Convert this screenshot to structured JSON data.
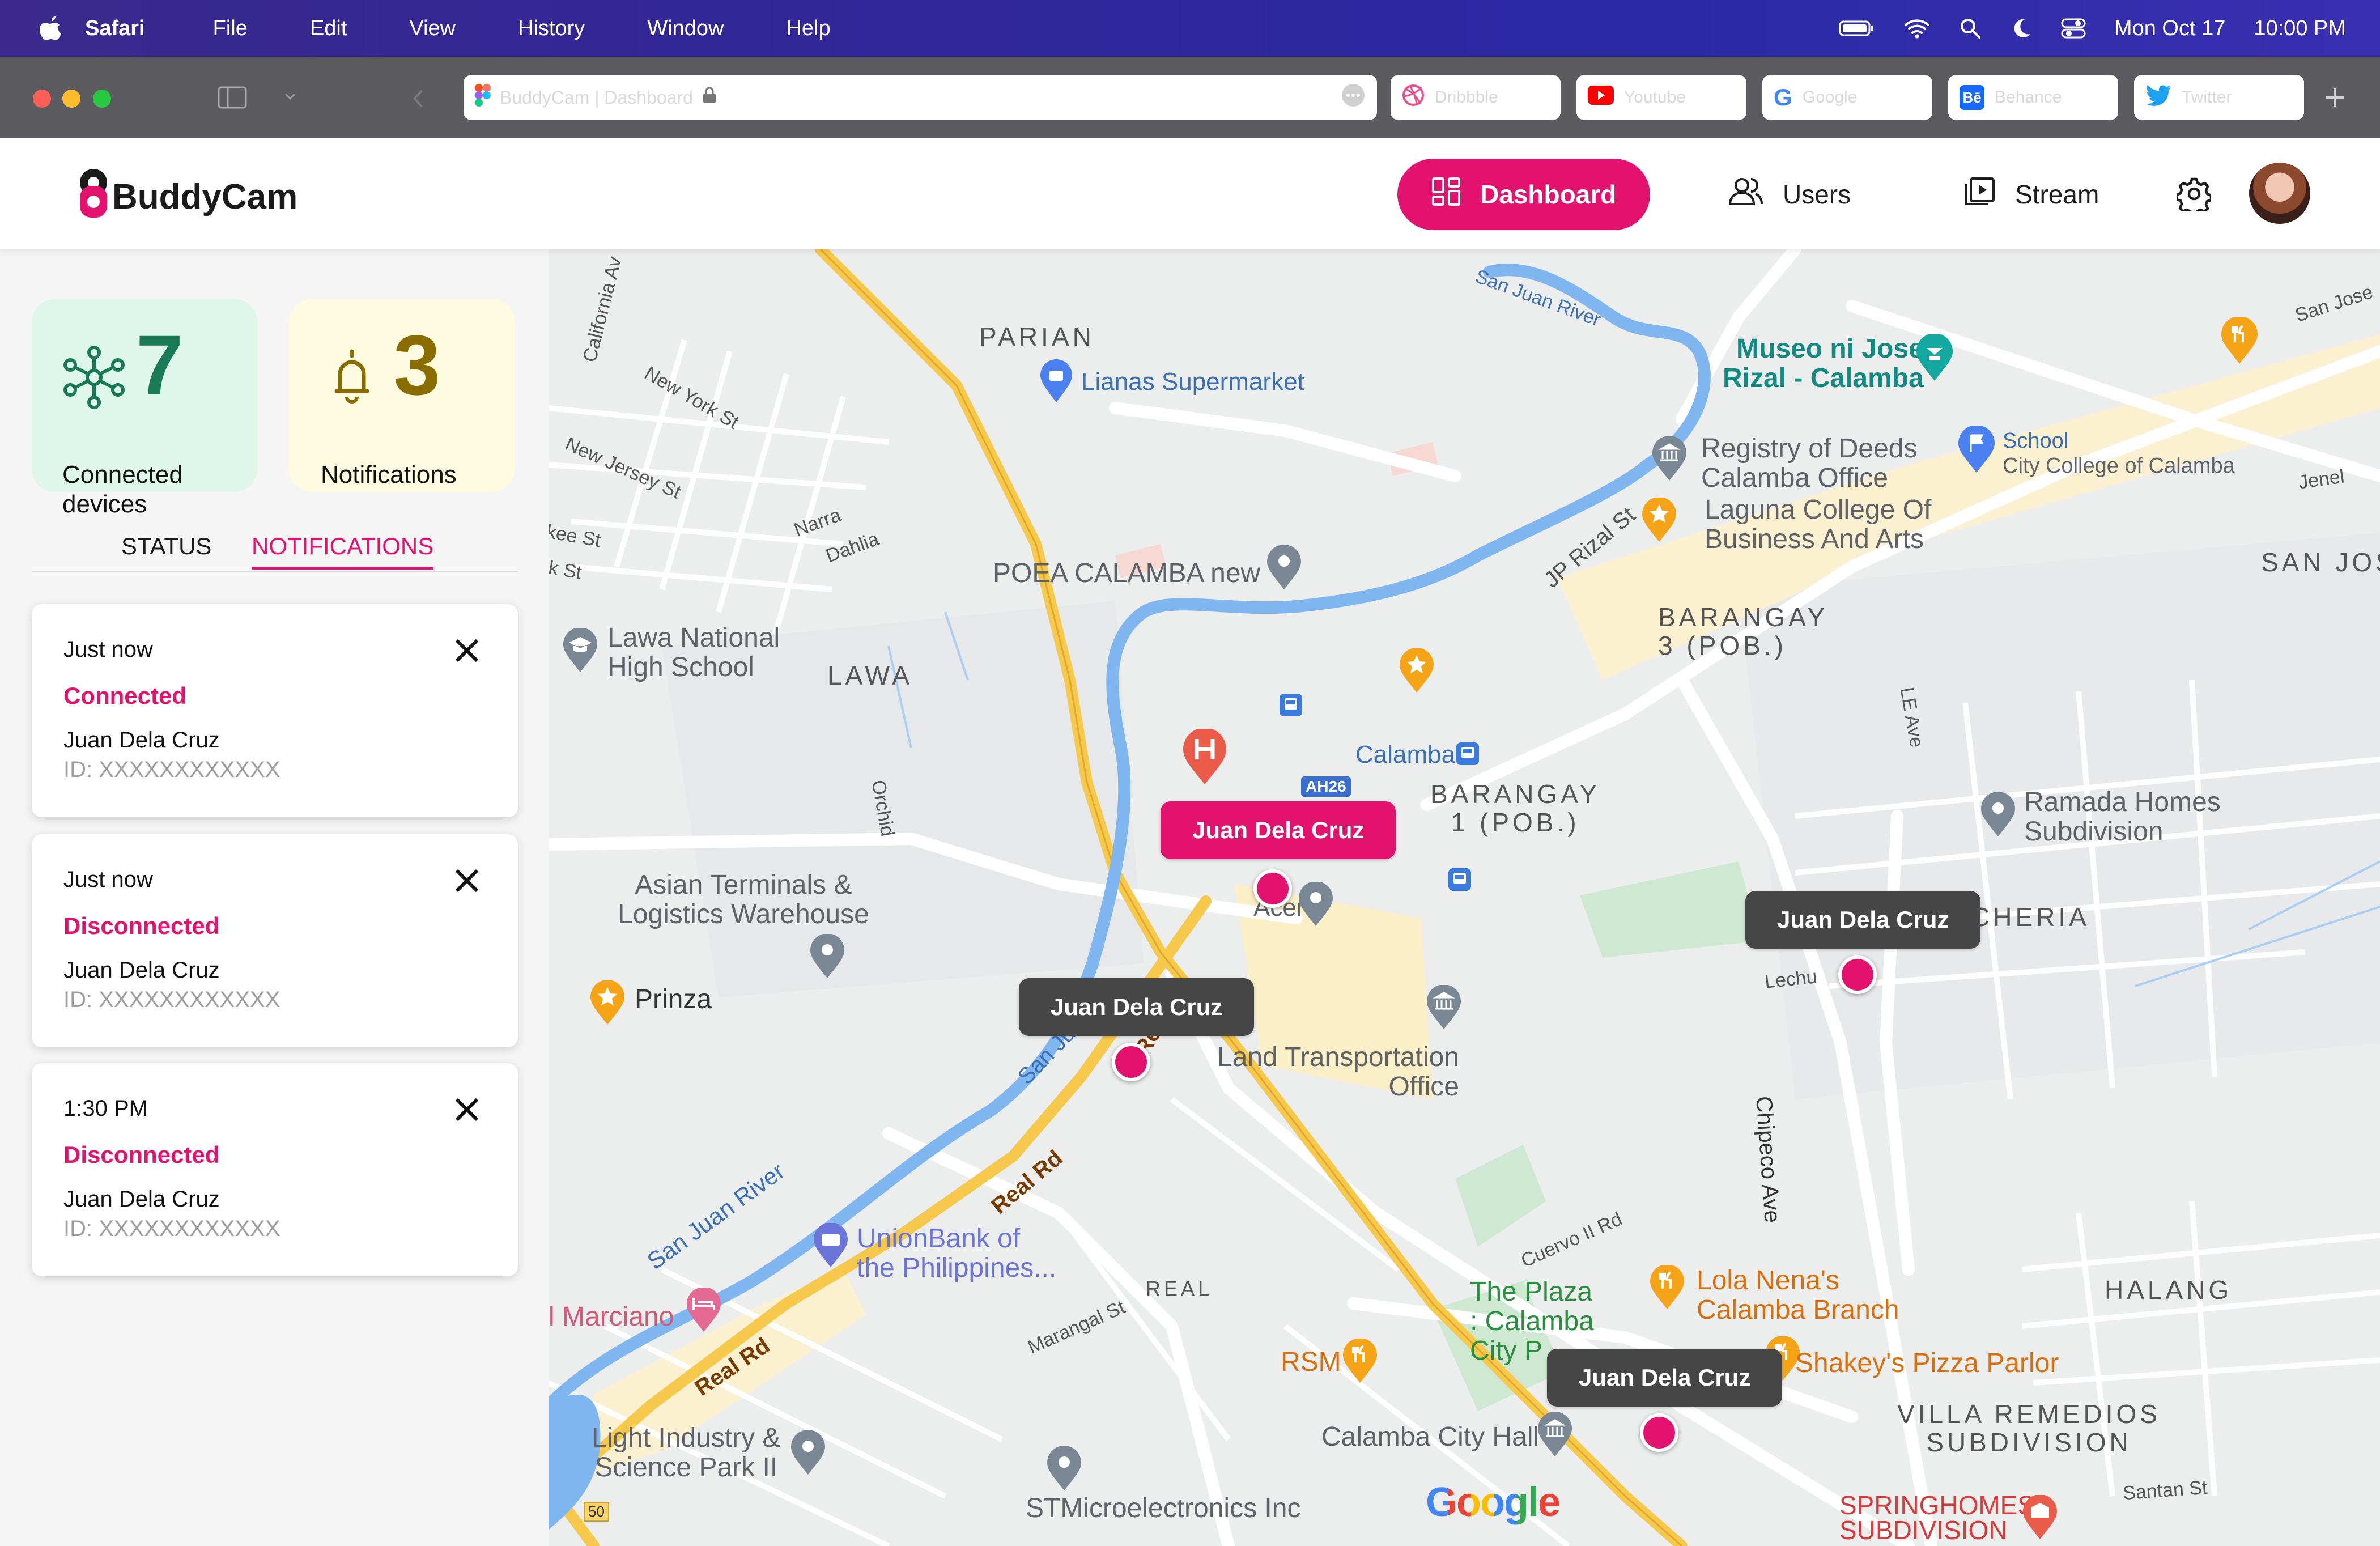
{
  "menubar": {
    "app": "Safari",
    "items": [
      "File",
      "Edit",
      "View",
      "History",
      "Window",
      "Help"
    ],
    "date": "Mon Oct 17",
    "time": "10:00 PM"
  },
  "browser": {
    "url_text": "BuddyCam | Dashboard",
    "tabs": [
      "Dribbble",
      "Youtube",
      "Google",
      "Behance",
      "Twitter"
    ]
  },
  "header": {
    "brand": "BuddyCam",
    "nav": {
      "dashboard": "Dashboard",
      "users": "Users",
      "stream": "Stream"
    }
  },
  "stats": {
    "connected": {
      "value": "7",
      "label": "Connected devices"
    },
    "notifications": {
      "value": "3",
      "label": "Notifications"
    }
  },
  "tabs": {
    "status": "STATUS",
    "notifications": "NOTIFICATIONS",
    "active": "notifications"
  },
  "notifications": [
    {
      "time": "Just now",
      "status": "Connected",
      "name": "Juan Dela Cruz",
      "id": "ID: XXXXXXXXXXXX"
    },
    {
      "time": "Just now",
      "status": "Disconnected",
      "name": "Juan Dela Cruz",
      "id": "ID: XXXXXXXXXXXX"
    },
    {
      "time": "1:30 PM",
      "status": "Disconnected",
      "name": "Juan Dela Cruz",
      "id": "ID: XXXXXXXXXXXX"
    }
  ],
  "map": {
    "markers": [
      {
        "label": "Juan Dela Cruz",
        "highlight": true
      },
      {
        "label": "Juan Dela Cruz",
        "highlight": false
      },
      {
        "label": "Juan Dela Cruz",
        "highlight": false
      },
      {
        "label": "Juan Dela Cruz",
        "highlight": false
      }
    ],
    "labels": {
      "parian": "PARIAN",
      "lianas": "Lianas Supermarket",
      "museo": "Museo ni Jose\nRizal - Calamba",
      "registry": "Registry of Deeds\nCalamba Office",
      "school": "School",
      "city_college": "City College of Calamba",
      "laguna_college": "Laguna College Of\nBusiness And Arts",
      "poea": "POEA CALAMBA new",
      "lawa_nhs": "Lawa National\nHigh School",
      "lawa": "LAWA",
      "barangay3": "BARANGAY\n3 (POB.)",
      "san_jos": "SAN JOS",
      "calamba": "Calamba",
      "barangay1": "BARANGAY\n1 (POB.)",
      "ramada": "Ramada Homes\nSubdivision",
      "asian_terminals": "Asian Terminals &\nLogistics Warehouse",
      "cheria": "CHERIA",
      "prinza": "Prinza",
      "acer": "Acer",
      "lto": "Land Transportation\nOffice",
      "unionbank": "UnionBank of\nthe Philippines...",
      "marciano": "l Marciano",
      "plaza": "The Plaza\n: Calamba\nCity P",
      "lola_nena": "Lola Nena's\nCalamba Branch",
      "halang": "HALANG",
      "rsm": "RSM",
      "shakeys": "Shakey's Pizza Parlor",
      "villa": "VILLA REMEDIOS\nSUBDIVISION",
      "light_industry": "Light Industry &\nScience Park II",
      "city_hall": "Calamba City Hall",
      "stmicro": "STMicroelectronics Inc",
      "springhomes": "SPRINGHOMES\nSUBDIVISION",
      "real": "REAL",
      "ah26": "AH26",
      "google": "Google"
    },
    "streets": {
      "san_juan_river_top": "San Juan River",
      "san_juan_river_bottom": "San Juan River",
      "san_juan_mid": "San Juan",
      "real_rd_1": "Real Rd",
      "real_rd_2": "Real Rd",
      "jp_rizal": "JP Rizal St",
      "california": "California Av",
      "new_york": "New York St",
      "new_jersey": "New Jersey St",
      "narra": "Narra",
      "dahlia": "Dahlia",
      "kee": "kee St",
      "k_st": "k St",
      "orchid": "Orchid",
      "le_ave": "LE Ave",
      "chipeco": "Chipeco Ave",
      "cuervo": "Cuervo II Rd",
      "marangal": "Marangal St",
      "santan": "Santan St",
      "lechu": "Lechu",
      "san_jose": "San Jose",
      "jenel": "Jenel",
      "re": "Re"
    }
  },
  "colors": {
    "accent": "#e3126f",
    "green_card": "#dff6ea",
    "yellow_card": "#fefbe0",
    "dark_bubble": "#464646"
  }
}
